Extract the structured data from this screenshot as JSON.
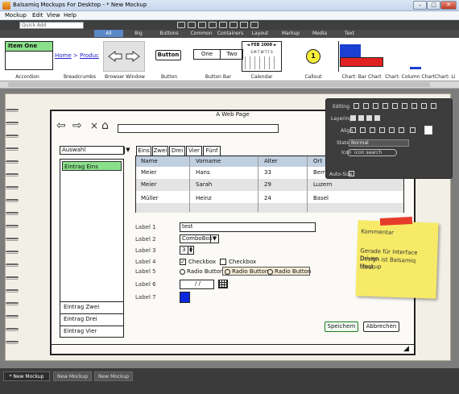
{
  "app": {
    "title": "Balsamiq Mockups For Desktop - * New Mockup"
  },
  "window_buttons": {
    "minimize": "–",
    "maximize": "□",
    "close": "✕"
  },
  "menu": [
    "Mockup",
    "Edit",
    "View",
    "Help"
  ],
  "quick_add": {
    "value": "Quick Add"
  },
  "categories": [
    "All",
    "Big",
    "Buttons",
    "Common",
    "Containers",
    "Layout",
    "Markup",
    "Media",
    "Text"
  ],
  "gallery": {
    "items": [
      "Accordion",
      "Breadcrumbs",
      "Browser Window",
      "Button",
      "Button Bar",
      "Calendar",
      "Callout",
      "Chart: Bar Chart",
      "Chart: Column Chart",
      "Chart: Li"
    ],
    "accordion_text": "Item One",
    "breadcrumb_home": "Home",
    "breadcrumb_sep": ">",
    "breadcrumb_prod": "Produc",
    "button_text": "Button",
    "buttonbar": [
      "One",
      "Two"
    ],
    "calendar_head": "◄ FEB 2008 ►",
    "calendar_days": "S M T W T F S",
    "callout_text": "1"
  },
  "mockup": {
    "page_title": "A Web Page",
    "select_value": "Auswahl",
    "select_arrow": "▼",
    "list_items": [
      "Eintrag Eins",
      "Eintrag Zwei",
      "Eintrag Drei",
      "Eintrag Vier"
    ],
    "tabs": [
      "Eins",
      "Zwei",
      "Drei",
      "Vier",
      "Fünf"
    ],
    "grid_headers": [
      "Name",
      "Vorname",
      "Alter",
      "Ort"
    ],
    "grid_rows": [
      [
        "Meier",
        "Hans",
        "33",
        "Bern"
      ],
      [
        "Meier",
        "Sarah",
        "29",
        "Luzern"
      ],
      [
        "Müller",
        "Heinz",
        "24",
        "Basel"
      ]
    ],
    "labels": [
      "Label 1",
      "Label 2",
      "Label 3",
      "Label 4",
      "Label 5",
      "Label 6",
      "Label 7"
    ],
    "text_value": "test",
    "combo_value": "ComboBox",
    "combo_arrow": "▼",
    "stepper_value": "3",
    "checkbox1": "Checkbox",
    "checkbox2": "Checkbox",
    "radio1": "Radio Button",
    "radio2": "Radio Button",
    "radio3": "Radio Button",
    "date_value": "/ /",
    "save_button": "Speichern",
    "cancel_button": "Abbrechen",
    "note_title": "Kommentar",
    "note_body": [
      "Gerade für Interface Driven",
      "Design ist Balsamiq Mockup",
      "ideal."
    ]
  },
  "inspector": {
    "editing": "Editing",
    "layering": "Layering",
    "align": "Align",
    "state": "State",
    "state_value": "Normal",
    "icon": "Icon",
    "icon_search": "icon search",
    "auto_size": "Auto-Size"
  },
  "bottom_tabs": [
    "* New Mockup",
    "New Mockup",
    "New Mockup"
  ],
  "colors": {
    "accent": "#5a87c6",
    "list_selected": "#8ae08a",
    "grid_header": "#bfcfdf",
    "note": "#f7ea67",
    "tape": "#e63c2a",
    "callout": "#f5ee3a",
    "chart_red": "#e02121",
    "chart_blue": "#1a3fd1"
  }
}
